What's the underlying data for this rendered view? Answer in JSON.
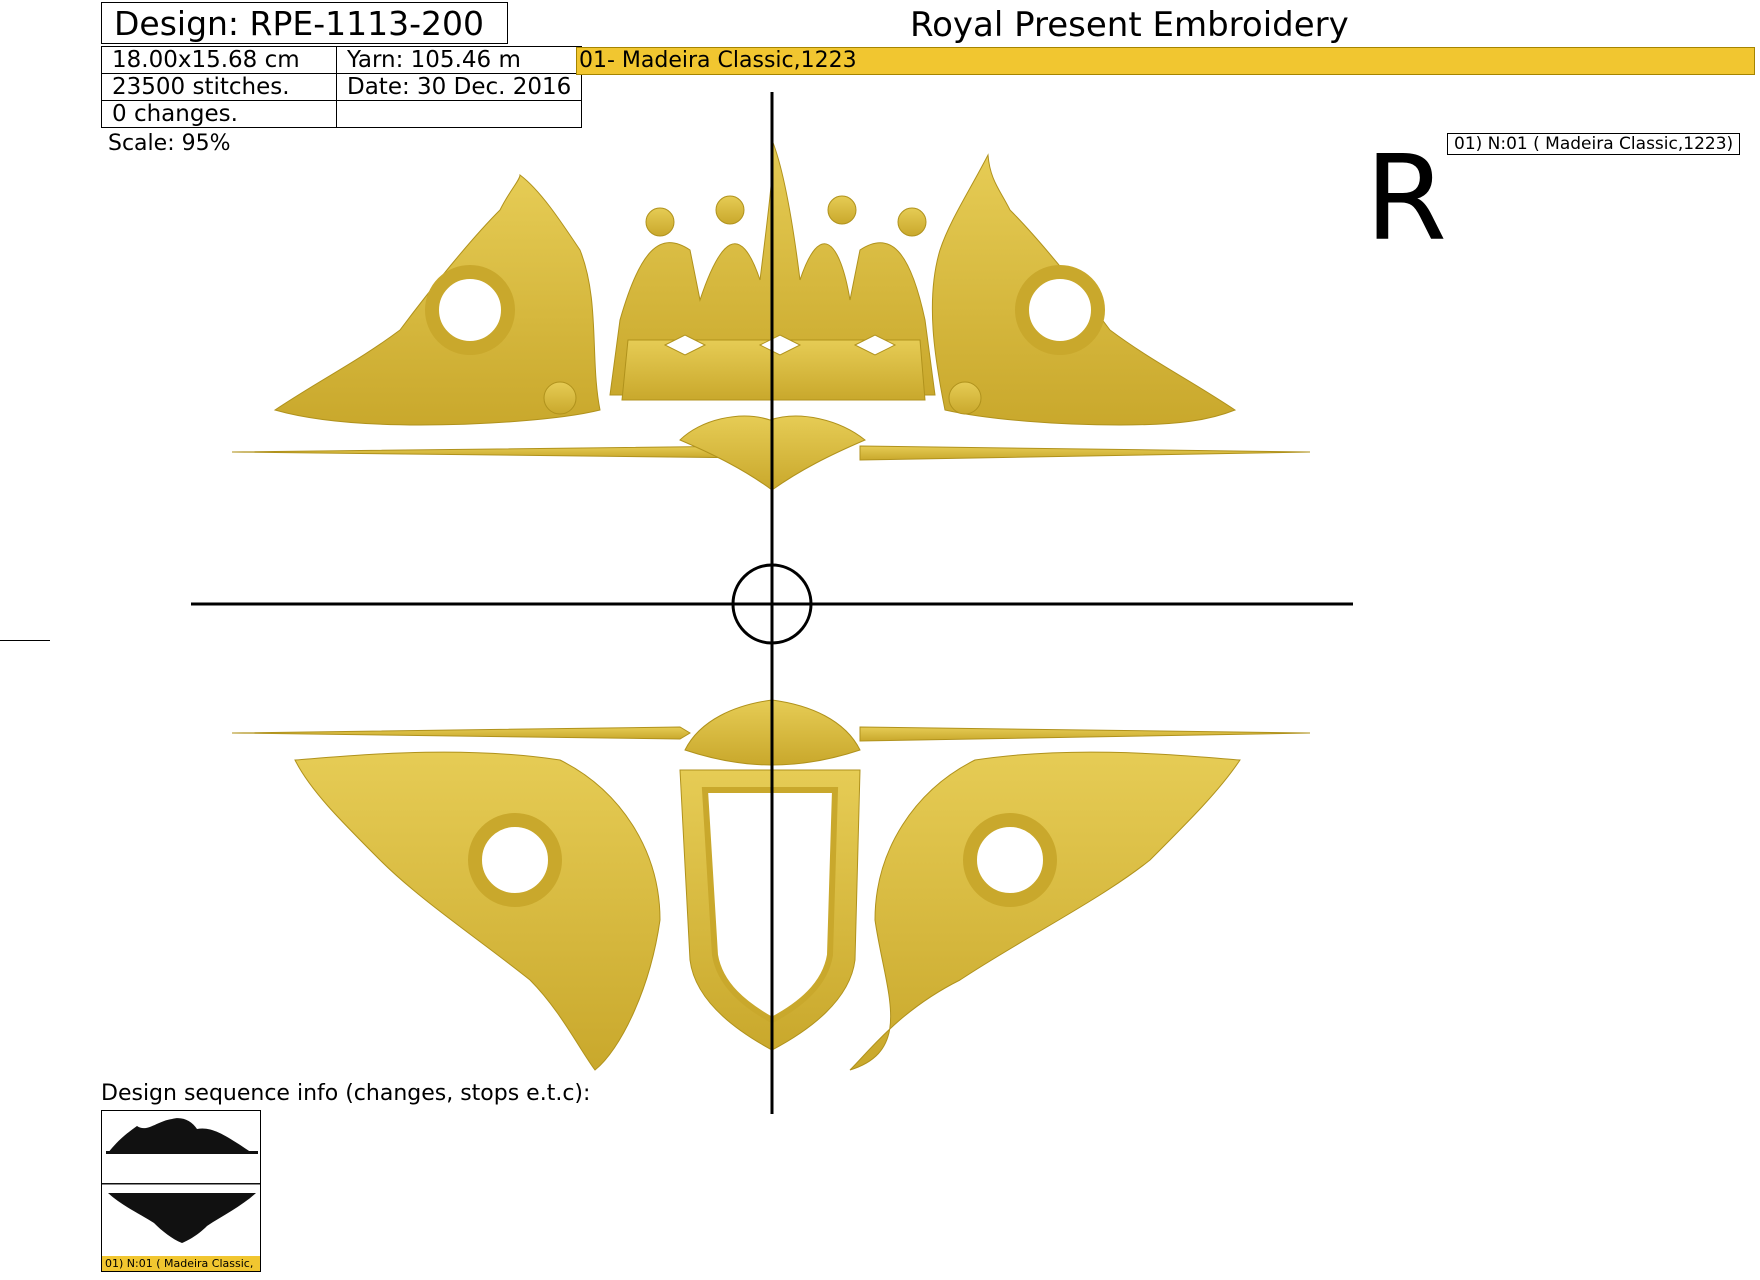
{
  "header": {
    "design_label": "Design: RPE-1113-200",
    "brand_title": "Royal Present Embroidery"
  },
  "info": {
    "size": "18.00x15.68 cm",
    "yarn": "Yarn: 105.46 m",
    "stitches": "23500 stitches.",
    "date": "Date: 30 Dec. 2016",
    "changes": "0 changes.",
    "empty": ""
  },
  "thread_bar": {
    "label": "01- Madeira Classic,1223",
    "color": "#f1c630"
  },
  "scale": "Scale: 95%",
  "legend": "01) N:01 ( Madeira Classic,1223)",
  "orientation_letter": "R",
  "sequence": {
    "label": "Design sequence info (changes, stops e.t.c):",
    "caption": "01) N:01 ( Madeira Classic,"
  },
  "colors": {
    "gold": "#d8bb3c",
    "gold_dark": "#b0921c",
    "sequence_bg": "#f1c630"
  }
}
